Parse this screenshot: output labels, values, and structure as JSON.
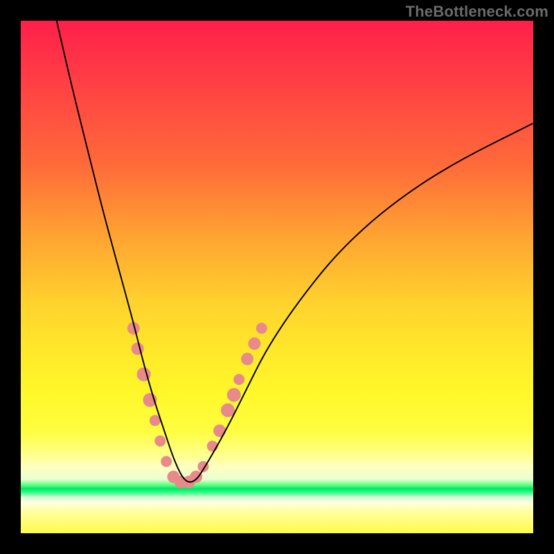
{
  "watermark": "TheBottleneck.com",
  "chart_data": {
    "type": "line",
    "title": "",
    "xlabel": "",
    "ylabel": "",
    "xlim": [
      0,
      100
    ],
    "ylim": [
      0,
      100
    ],
    "grid": false,
    "legend": false,
    "background_gradient": {
      "direction": "vertical",
      "stops": [
        {
          "pos": 0,
          "color": "#ff1f4a"
        },
        {
          "pos": 28,
          "color": "#ff6a3a"
        },
        {
          "pos": 55,
          "color": "#ffd22e"
        },
        {
          "pos": 73,
          "color": "#fff82a"
        },
        {
          "pos": 87,
          "color": "#ffffc0"
        },
        {
          "pos": 91,
          "color": "#00e56a"
        },
        {
          "pos": 94,
          "color": "#ffffe0"
        },
        {
          "pos": 100,
          "color": "#fffb4a"
        }
      ]
    },
    "series": [
      {
        "name": "curve",
        "color": "#000000",
        "stroke_width": 2,
        "x": [
          7,
          10,
          13,
          16,
          19,
          22,
          24,
          26,
          28,
          30,
          32,
          34,
          36,
          40,
          44,
          48,
          54,
          62,
          72,
          84,
          100
        ],
        "y": [
          100,
          87,
          75,
          63,
          52,
          41,
          33,
          26,
          20,
          14,
          10,
          10,
          13,
          20,
          28,
          36,
          45,
          55,
          64,
          72,
          80
        ]
      }
    ],
    "markers": {
      "name": "dots",
      "color": "#e98a8a",
      "radius_major": 10,
      "radius_minor": 7,
      "points": [
        {
          "x": 22.0,
          "y": 40,
          "r": 9
        },
        {
          "x": 22.8,
          "y": 36,
          "r": 9
        },
        {
          "x": 24.0,
          "y": 31,
          "r": 10
        },
        {
          "x": 25.2,
          "y": 26,
          "r": 10
        },
        {
          "x": 26.2,
          "y": 22,
          "r": 8
        },
        {
          "x": 27.2,
          "y": 18,
          "r": 8
        },
        {
          "x": 28.4,
          "y": 14,
          "r": 8
        },
        {
          "x": 29.8,
          "y": 11,
          "r": 9
        },
        {
          "x": 31.2,
          "y": 10,
          "r": 9
        },
        {
          "x": 32.8,
          "y": 10,
          "r": 9
        },
        {
          "x": 34.2,
          "y": 11,
          "r": 9
        },
        {
          "x": 35.6,
          "y": 13,
          "r": 8
        },
        {
          "x": 37.4,
          "y": 17,
          "r": 8
        },
        {
          "x": 38.8,
          "y": 20,
          "r": 9
        },
        {
          "x": 40.4,
          "y": 24,
          "r": 10
        },
        {
          "x": 41.6,
          "y": 27,
          "r": 10
        },
        {
          "x": 42.6,
          "y": 30,
          "r": 8
        },
        {
          "x": 44.2,
          "y": 34,
          "r": 9
        },
        {
          "x": 45.6,
          "y": 37,
          "r": 9
        },
        {
          "x": 47.0,
          "y": 40,
          "r": 8
        }
      ]
    }
  }
}
